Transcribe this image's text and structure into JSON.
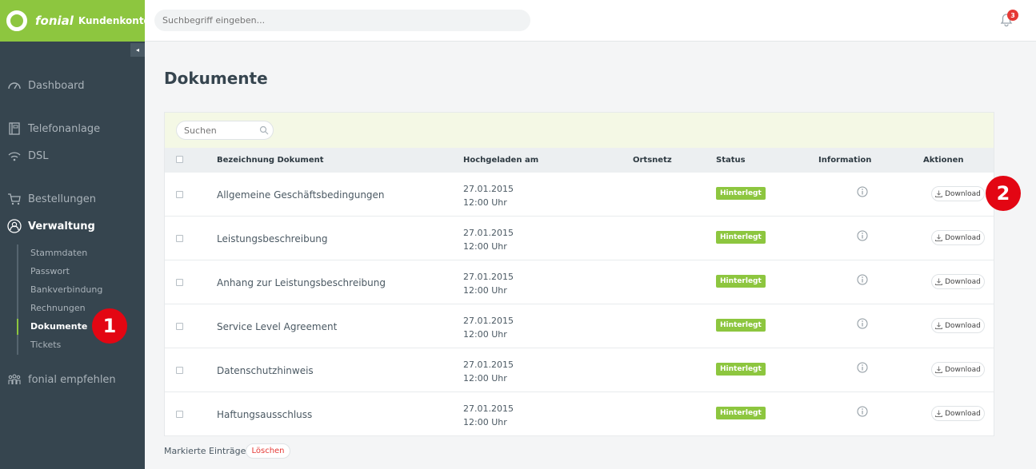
{
  "brand": {
    "name": "fonial",
    "subtitle": "Kundenkonto"
  },
  "header": {
    "search_placeholder": "Suchbegriff eingeben...",
    "notification_count": "3"
  },
  "sidebar": {
    "collapse_icon": "◂",
    "items": [
      {
        "label": "Dashboard",
        "icon": "speedometer-icon"
      },
      {
        "label": "Telefonanlage",
        "icon": "phone-icon"
      },
      {
        "label": "DSL",
        "icon": "wifi-icon"
      },
      {
        "label": "Bestellungen",
        "icon": "cart-icon"
      },
      {
        "label": "Verwaltung",
        "icon": "user-icon"
      },
      {
        "label": "fonial empfehlen",
        "icon": "people-icon"
      }
    ],
    "subitems": [
      "Stammdaten",
      "Passwort",
      "Bankverbindung",
      "Rechnungen",
      "Dokumente",
      "Tickets"
    ]
  },
  "page": {
    "title": "Dokumente"
  },
  "filter": {
    "placeholder": "Suchen"
  },
  "table": {
    "columns": [
      "Bezeichnung Dokument",
      "Hochgeladen am",
      "Ortsnetz",
      "Status",
      "Information",
      "Aktionen"
    ],
    "rows": [
      {
        "name": "Allgemeine Geschäftsbedingungen",
        "date": "27.01.2015",
        "time": "12:00 Uhr",
        "status": "Hinterlegt",
        "action": "Download"
      },
      {
        "name": "Leistungsbeschreibung",
        "date": "27.01.2015",
        "time": "12:00 Uhr",
        "status": "Hinterlegt",
        "action": "Download"
      },
      {
        "name": "Anhang zur Leistungsbeschreibung",
        "date": "27.01.2015",
        "time": "12:00 Uhr",
        "status": "Hinterlegt",
        "action": "Download"
      },
      {
        "name": "Service Level Agreement",
        "date": "27.01.2015",
        "time": "12:00 Uhr",
        "status": "Hinterlegt",
        "action": "Download"
      },
      {
        "name": "Datenschutzhinweis",
        "date": "27.01.2015",
        "time": "12:00 Uhr",
        "status": "Hinterlegt",
        "action": "Download"
      },
      {
        "name": "Haftungsausschluss",
        "date": "27.01.2015",
        "time": "12:00 Uhr",
        "status": "Hinterlegt",
        "action": "Download"
      }
    ]
  },
  "footer": {
    "marked_label": "Markierte Einträge",
    "delete_label": "Löschen"
  },
  "markers": [
    "1",
    "2"
  ],
  "colors": {
    "brand_green": "#8dc63f",
    "sidebar_bg": "#36454f",
    "marker_red": "#e30613"
  }
}
